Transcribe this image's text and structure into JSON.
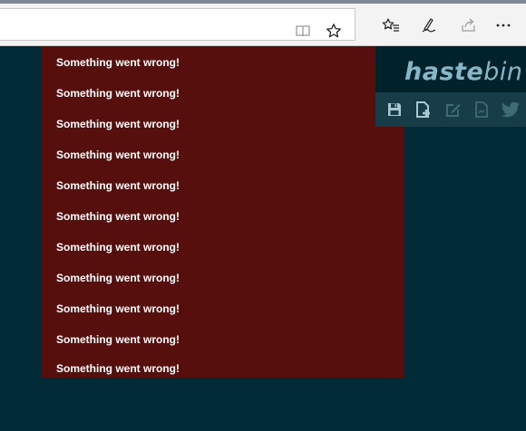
{
  "errors": [
    "Something went wrong!",
    "Something went wrong!",
    "Something went wrong!",
    "Something went wrong!",
    "Something went wrong!",
    "Something went wrong!",
    "Something went wrong!",
    "Something went wrong!",
    "Something went wrong!",
    "Something went wrong!",
    "Something went wrong!"
  ],
  "logo": {
    "bold": "haste",
    "light": "bin"
  },
  "toolbar_icons": [
    "reading-view-icon",
    "favorite-star-icon",
    "favorites-list-icon",
    "pen-icon",
    "share-icon",
    "more-icon"
  ],
  "haste_buttons": [
    "save-icon",
    "new-icon",
    "duplicate-edit-icon",
    "raw-icon",
    "twitter-icon"
  ],
  "colors": {
    "background": "#002b36",
    "error_background": "#560f0d",
    "logo_box": "#00222b",
    "button_bar": "#173e48",
    "logo_text": "#87b7c6"
  }
}
